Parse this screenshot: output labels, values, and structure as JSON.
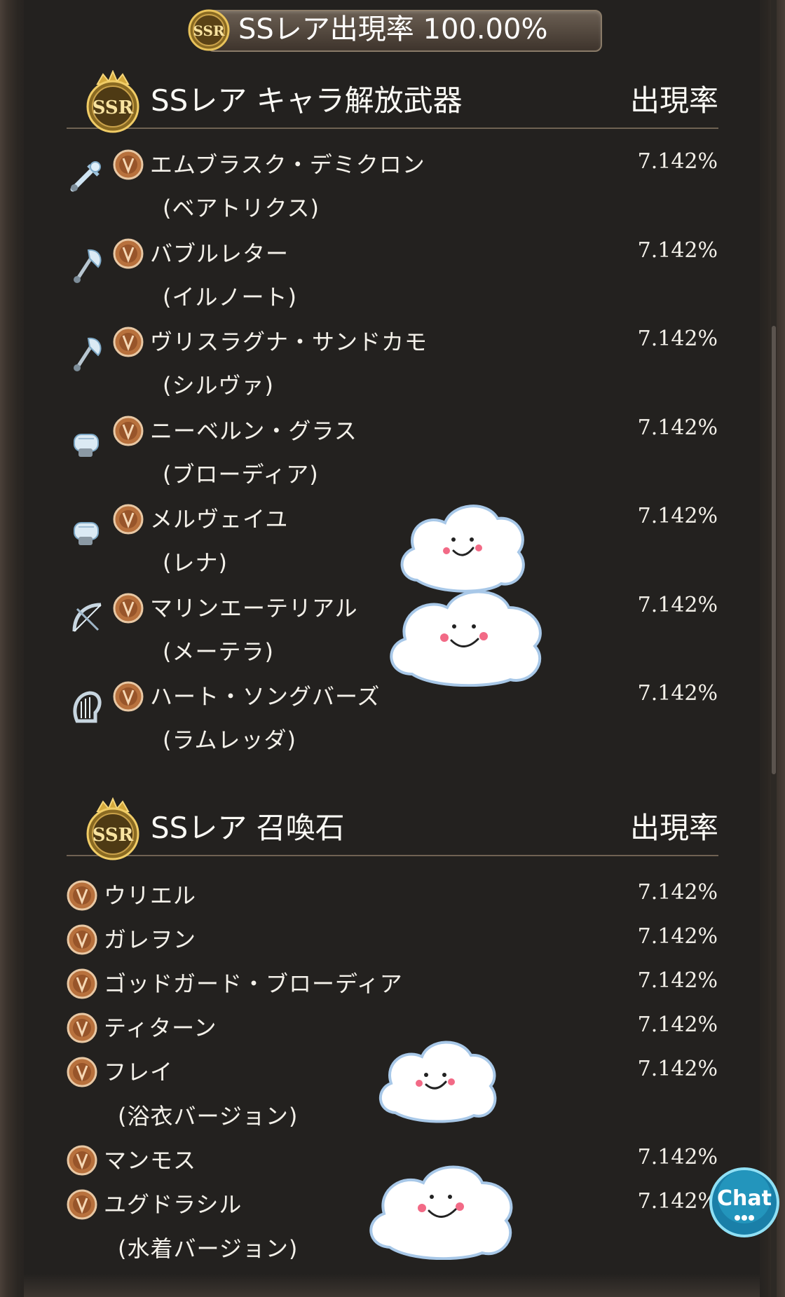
{
  "banner": {
    "text": "SSレア出現率 100.00%",
    "badge": "SSR"
  },
  "weapons_section": {
    "title": "SSレア キャラ解放武器",
    "rate_label": "出現率",
    "badge": "SSR",
    "items": [
      {
        "name": "エムブラスク・デミクロン",
        "sub": "(ベアトリクス)",
        "rate": "7.142%",
        "weapon_icon": "sword-icon"
      },
      {
        "name": "バブルレター",
        "sub": "(イルノート)",
        "rate": "7.142%",
        "weapon_icon": "axe-icon"
      },
      {
        "name": "ヴリスラグナ・サンドカモ",
        "sub": "(シルヴァ)",
        "rate": "7.142%",
        "weapon_icon": "axe-icon"
      },
      {
        "name": "ニーベルン・グラス",
        "sub": "(ブローディア)",
        "rate": "7.142%",
        "weapon_icon": "fist-icon"
      },
      {
        "name": "メルヴェイユ",
        "sub": "(レナ)",
        "rate": "7.142%",
        "weapon_icon": "fist-icon"
      },
      {
        "name": "マリンエーテリアル",
        "sub": "(メーテラ)",
        "rate": "7.142%",
        "weapon_icon": "bow-icon"
      },
      {
        "name": "ハート・ソングバーズ",
        "sub": "(ラムレッダ)",
        "rate": "7.142%",
        "weapon_icon": "harp-icon"
      }
    ]
  },
  "summons_section": {
    "title": "SSレア 召喚石",
    "rate_label": "出現率",
    "badge": "SSR",
    "items": [
      {
        "name": "ウリエル",
        "sub": "",
        "rate": "7.142%"
      },
      {
        "name": "ガレヲン",
        "sub": "",
        "rate": "7.142%"
      },
      {
        "name": "ゴッドガード・ブローディア",
        "sub": "",
        "rate": "7.142%"
      },
      {
        "name": "ティターン",
        "sub": "",
        "rate": "7.142%"
      },
      {
        "name": "フレイ",
        "sub": "(浴衣バージョン)",
        "rate": "7.142%"
      },
      {
        "name": "マンモス",
        "sub": "",
        "rate": "7.142%"
      },
      {
        "name": "ユグドラシル",
        "sub": "(水着バージョン)",
        "rate": "7.142%"
      }
    ]
  },
  "chat": {
    "label": "Chat"
  },
  "colors": {
    "element_earth": "#b8713d",
    "panel_bg": "#23211f",
    "divider": "#6f6253"
  }
}
